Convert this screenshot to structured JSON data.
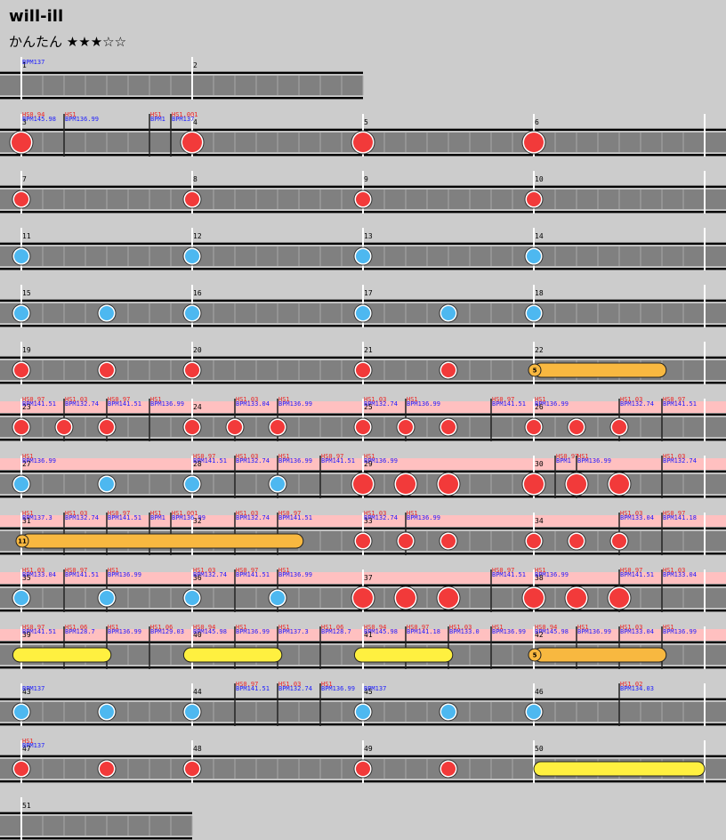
{
  "song": {
    "title": "will-ill",
    "difficulty": "かんたん",
    "stars": "★★★☆☆"
  },
  "colors": {
    "background": "#cccccc",
    "lane": "#808080",
    "lane_border": "#000000",
    "highlight_row": "#ffc0c0",
    "don": "#f23a3a",
    "ka": "#4db8f0",
    "drumroll": "#f8b840",
    "balloon": "#fff040",
    "bpm_text": "#1a1aff",
    "hs_text": "#ee2222"
  },
  "rows": [
    {
      "measures": [
        {
          "n": "1",
          "beats": 4
        },
        {
          "n": "2",
          "beats": 4
        }
      ],
      "highlight": false,
      "events": [
        {
          "t": 0,
          "bpm": "BPM137"
        }
      ],
      "notes": []
    },
    {
      "measures": [
        {
          "n": "3",
          "beats": 4
        },
        {
          "n": "4",
          "beats": 4
        },
        {
          "n": "5",
          "beats": 4
        },
        {
          "n": "6",
          "beats": 4
        }
      ],
      "highlight": false,
      "events": [
        {
          "t": 0,
          "hs": "HS0.94",
          "bpm": "BPM145.98"
        },
        {
          "t": 1,
          "hs": "HS1",
          "bpm": "BPM136.99"
        },
        {
          "t": 3,
          "hs": "HS1",
          "bpm": "BPM1"
        },
        {
          "t": 3.5,
          "hs": "HS1.001",
          "bpm": "BPM137"
        }
      ],
      "notes": [
        {
          "t": 0,
          "k": "D"
        },
        {
          "t": 4,
          "k": "D"
        },
        {
          "t": 8,
          "k": "D"
        },
        {
          "t": 12,
          "k": "D"
        }
      ]
    },
    {
      "measures": [
        {
          "n": "7",
          "beats": 4
        },
        {
          "n": "8",
          "beats": 4
        },
        {
          "n": "9",
          "beats": 4
        },
        {
          "n": "10",
          "beats": 4
        }
      ],
      "highlight": false,
      "events": [],
      "notes": [
        {
          "t": 0,
          "k": "d"
        },
        {
          "t": 4,
          "k": "d"
        },
        {
          "t": 8,
          "k": "d"
        },
        {
          "t": 12,
          "k": "d"
        }
      ]
    },
    {
      "measures": [
        {
          "n": "11",
          "beats": 4
        },
        {
          "n": "12",
          "beats": 4
        },
        {
          "n": "13",
          "beats": 4
        },
        {
          "n": "14",
          "beats": 4
        }
      ],
      "highlight": false,
      "events": [],
      "notes": [
        {
          "t": 0,
          "k": "k"
        },
        {
          "t": 4,
          "k": "k"
        },
        {
          "t": 8,
          "k": "k"
        },
        {
          "t": 12,
          "k": "k"
        }
      ]
    },
    {
      "measures": [
        {
          "n": "15",
          "beats": 4
        },
        {
          "n": "16",
          "beats": 4
        },
        {
          "n": "17",
          "beats": 4
        },
        {
          "n": "18",
          "beats": 4
        }
      ],
      "highlight": false,
      "events": [],
      "notes": [
        {
          "t": 0,
          "k": "k"
        },
        {
          "t": 2,
          "k": "k"
        },
        {
          "t": 4,
          "k": "k"
        },
        {
          "t": 8,
          "k": "k"
        },
        {
          "t": 10,
          "k": "k"
        },
        {
          "t": 12,
          "k": "k"
        }
      ]
    },
    {
      "measures": [
        {
          "n": "19",
          "beats": 4
        },
        {
          "n": "20",
          "beats": 4
        },
        {
          "n": "21",
          "beats": 4
        },
        {
          "n": "22",
          "beats": 4
        }
      ],
      "highlight": false,
      "events": [],
      "notes": [
        {
          "t": 0,
          "k": "d"
        },
        {
          "t": 2,
          "k": "d"
        },
        {
          "t": 4,
          "k": "d"
        },
        {
          "t": 8,
          "k": "d"
        },
        {
          "t": 10,
          "k": "d"
        },
        {
          "t": 12,
          "k": "r",
          "end": 15.1,
          "label": "5"
        }
      ]
    },
    {
      "measures": [
        {
          "n": "23",
          "beats": 4
        },
        {
          "n": "24",
          "beats": 4
        },
        {
          "n": "25",
          "beats": 4
        },
        {
          "n": "26",
          "beats": 4
        }
      ],
      "highlight": true,
      "events": [
        {
          "t": 0,
          "hs": "HS0.97",
          "bpm": "BPM141.51"
        },
        {
          "t": 1,
          "hs": "HS1.03",
          "bpm": "BPM132.74"
        },
        {
          "t": 2,
          "hs": "HS0.97",
          "bpm": "BPM141.51"
        },
        {
          "t": 3,
          "hs": "HS1",
          "bpm": "BPM136.99"
        },
        {
          "t": 5,
          "hs": "HS1.03",
          "bpm": "BPM133.04"
        },
        {
          "t": 6,
          "hs": "HS1",
          "bpm": "BPM136.99"
        },
        {
          "t": 8,
          "hs": "HS1.03",
          "bpm": "BPM132.74"
        },
        {
          "t": 9,
          "hs": "HS1",
          "bpm": "BPM136.99"
        },
        {
          "t": 11,
          "hs": "HS0.97",
          "bpm": "BPM141.51"
        },
        {
          "t": 12,
          "hs": "HS1",
          "bpm": "BPM136.99"
        },
        {
          "t": 14,
          "hs": "HS1.03",
          "bpm": "BPM132.74"
        },
        {
          "t": 15,
          "hs": "HS0.97",
          "bpm": "BPM141.51"
        }
      ],
      "notes": [
        {
          "t": 0,
          "k": "d"
        },
        {
          "t": 1,
          "k": "d"
        },
        {
          "t": 2,
          "k": "d"
        },
        {
          "t": 4,
          "k": "d"
        },
        {
          "t": 5,
          "k": "d"
        },
        {
          "t": 6,
          "k": "d"
        },
        {
          "t": 8,
          "k": "d"
        },
        {
          "t": 9,
          "k": "d"
        },
        {
          "t": 10,
          "k": "d"
        },
        {
          "t": 12,
          "k": "d"
        },
        {
          "t": 13,
          "k": "d"
        },
        {
          "t": 14,
          "k": "d"
        }
      ]
    },
    {
      "measures": [
        {
          "n": "27",
          "beats": 4
        },
        {
          "n": "28",
          "beats": 4
        },
        {
          "n": "29",
          "beats": 4
        },
        {
          "n": "30",
          "beats": 4
        }
      ],
      "highlight": true,
      "events": [
        {
          "t": 0,
          "hs": "HS1",
          "bpm": "BPM136.99"
        },
        {
          "t": 4,
          "hs": "HS0.97",
          "bpm": "BPM141.51"
        },
        {
          "t": 5,
          "hs": "HS1.03",
          "bpm": "BPM132.74"
        },
        {
          "t": 6,
          "hs": "HS1",
          "bpm": "BPM136.99"
        },
        {
          "t": 7,
          "hs": "HS0.97",
          "bpm": "BPM141.51"
        },
        {
          "t": 8,
          "hs": "HS1",
          "bpm": "BPM136.99"
        },
        {
          "t": 12.5,
          "hs": "HS0.97",
          "bpm": "BPM1"
        },
        {
          "t": 13,
          "hs": "HS1",
          "bpm": "BPM136.99"
        },
        {
          "t": 15,
          "hs": "HS1.03",
          "bpm": "BPM132.74"
        }
      ],
      "notes": [
        {
          "t": 0,
          "k": "k"
        },
        {
          "t": 2,
          "k": "k"
        },
        {
          "t": 4,
          "k": "k"
        },
        {
          "t": 6,
          "k": "k"
        },
        {
          "t": 8,
          "k": "D"
        },
        {
          "t": 9,
          "k": "D"
        },
        {
          "t": 10,
          "k": "D"
        },
        {
          "t": 12,
          "k": "D"
        },
        {
          "t": 13,
          "k": "D"
        },
        {
          "t": 14,
          "k": "D"
        }
      ]
    },
    {
      "measures": [
        {
          "n": "31",
          "beats": 4
        },
        {
          "n": "32",
          "beats": 4
        },
        {
          "n": "33",
          "beats": 4
        },
        {
          "n": "34",
          "beats": 4
        }
      ],
      "highlight": true,
      "events": [
        {
          "t": 0,
          "hs": "HS1",
          "bpm": "BPM137.3"
        },
        {
          "t": 1,
          "hs": "HS1.03",
          "bpm": "BPM132.74"
        },
        {
          "t": 2,
          "hs": "HS0.97",
          "bpm": "BPM141.51"
        },
        {
          "t": 3,
          "hs": "HS1",
          "bpm": "BPM1"
        },
        {
          "t": 3.5,
          "hs": "HS1.001",
          "bpm": "BPM136.99"
        },
        {
          "t": 5,
          "hs": "HS1.03",
          "bpm": "BPM132.74"
        },
        {
          "t": 6,
          "hs": "HS0.97",
          "bpm": "BPM141.51"
        },
        {
          "t": 8,
          "hs": "HS1.03",
          "bpm": "BPM132.74"
        },
        {
          "t": 9,
          "hs": "HS1",
          "bpm": "BPM136.99"
        },
        {
          "t": 14,
          "hs": "HS1.03",
          "bpm": "BPM133.04"
        },
        {
          "t": 15,
          "hs": "HS0.97",
          "bpm": "BPM141.18"
        }
      ],
      "notes": [
        {
          "t": 0,
          "k": "r",
          "end": 6.6,
          "label": "11"
        },
        {
          "t": 8,
          "k": "d"
        },
        {
          "t": 9,
          "k": "d"
        },
        {
          "t": 10,
          "k": "d"
        },
        {
          "t": 12,
          "k": "d"
        },
        {
          "t": 13,
          "k": "d"
        },
        {
          "t": 14,
          "k": "d"
        }
      ]
    },
    {
      "measures": [
        {
          "n": "35",
          "beats": 4
        },
        {
          "n": "36",
          "beats": 4
        },
        {
          "n": "37",
          "beats": 4
        },
        {
          "n": "38",
          "beats": 4
        }
      ],
      "highlight": true,
      "events": [
        {
          "t": 0,
          "hs": "HS1.03",
          "bpm": "BPM133.04"
        },
        {
          "t": 1,
          "hs": "HS0.97",
          "bpm": "BPM141.51"
        },
        {
          "t": 2,
          "hs": "HS1",
          "bpm": "BPM136.99"
        },
        {
          "t": 4,
          "hs": "HS1.03",
          "bpm": "BPM132.74"
        },
        {
          "t": 5,
          "hs": "HS0.97",
          "bpm": "BPM141.51"
        },
        {
          "t": 6,
          "hs": "HS1",
          "bpm": "BPM136.99"
        },
        {
          "t": 11,
          "hs": "HS0.97",
          "bpm": "BPM141.51"
        },
        {
          "t": 12,
          "hs": "HS1",
          "bpm": "BPM136.99"
        },
        {
          "t": 14,
          "hs": "HS0.97",
          "bpm": "BPM141.51"
        },
        {
          "t": 15,
          "hs": "HS1.03",
          "bpm": "BPM133.04"
        }
      ],
      "notes": [
        {
          "t": 0,
          "k": "k"
        },
        {
          "t": 2,
          "k": "k"
        },
        {
          "t": 4,
          "k": "k"
        },
        {
          "t": 6,
          "k": "k"
        },
        {
          "t": 8,
          "k": "D"
        },
        {
          "t": 9,
          "k": "D"
        },
        {
          "t": 10,
          "k": "D"
        },
        {
          "t": 12,
          "k": "D"
        },
        {
          "t": 13,
          "k": "D"
        },
        {
          "t": 14,
          "k": "D"
        }
      ]
    },
    {
      "measures": [
        {
          "n": "39",
          "beats": 4
        },
        {
          "n": "40",
          "beats": 4
        },
        {
          "n": "41",
          "beats": 4
        },
        {
          "n": "42",
          "beats": 4
        }
      ],
      "highlight": true,
      "events": [
        {
          "t": 0,
          "hs": "HS0.97",
          "bpm": "BPM141.51"
        },
        {
          "t": 1,
          "hs": "HS1.06",
          "bpm": "BPM128.7"
        },
        {
          "t": 2,
          "hs": "HS1",
          "bpm": "BPM136.99"
        },
        {
          "t": 3,
          "hs": "HS1.06",
          "bpm": "BPM129.03"
        },
        {
          "t": 4,
          "hs": "HS0.94",
          "bpm": "BPM145.98"
        },
        {
          "t": 5,
          "hs": "HS1",
          "bpm": "BPM136.99"
        },
        {
          "t": 6,
          "hs": "HS1",
          "bpm": "BPM137.3"
        },
        {
          "t": 7,
          "hs": "HS1.06",
          "bpm": "BPM128.7"
        },
        {
          "t": 8,
          "hs": "HS0.94",
          "bpm": "BPM145.98"
        },
        {
          "t": 9,
          "hs": "HS0.97",
          "bpm": "BPM141.18"
        },
        {
          "t": 10,
          "hs": "HS1.03",
          "bpm": "BPM133.0"
        },
        {
          "t": 11,
          "hs": "HS1",
          "bpm": "BPM136.99"
        },
        {
          "t": 12,
          "hs": "HS0.94",
          "bpm": "BPM145.98"
        },
        {
          "t": 13,
          "hs": "HS1",
          "bpm": "BPM136.99"
        },
        {
          "t": 14,
          "hs": "HS1.03",
          "bpm": "BPM133.04"
        },
        {
          "t": 15,
          "hs": "HS1",
          "bpm": "BPM136.99"
        }
      ],
      "notes": [
        {
          "t": -0.2,
          "k": "b",
          "end": 2.1
        },
        {
          "t": 3.8,
          "k": "b",
          "end": 6.1
        },
        {
          "t": 7.8,
          "k": "b",
          "end": 10.1
        },
        {
          "t": 12,
          "k": "r",
          "end": 15.1,
          "label": "5"
        }
      ]
    },
    {
      "measures": [
        {
          "n": "43",
          "beats": 4
        },
        {
          "n": "44",
          "beats": 4
        },
        {
          "n": "45",
          "beats": 4
        },
        {
          "n": "46",
          "beats": 4
        }
      ],
      "highlight": false,
      "events": [
        {
          "t": 0,
          "bpm": "BPM137"
        },
        {
          "t": 5,
          "hs": "HS0.97",
          "bpm": "BPM141.51"
        },
        {
          "t": 6,
          "hs": "HS1.03",
          "bpm": "BPM132.74"
        },
        {
          "t": 7,
          "hs": "HS1",
          "bpm": "BPM136.99"
        },
        {
          "t": 8,
          "bpm": "BPM137"
        },
        {
          "t": 14,
          "hs": "HS1.02",
          "bpm": "BPM134.03"
        }
      ],
      "notes": [
        {
          "t": 0,
          "k": "k"
        },
        {
          "t": 2,
          "k": "k"
        },
        {
          "t": 4,
          "k": "k"
        },
        {
          "t": 8,
          "k": "k"
        },
        {
          "t": 10,
          "k": "k"
        },
        {
          "t": 12,
          "k": "k"
        }
      ]
    },
    {
      "measures": [
        {
          "n": "47",
          "beats": 4
        },
        {
          "n": "48",
          "beats": 4
        },
        {
          "n": "49",
          "beats": 4
        },
        {
          "n": "50",
          "beats": 4
        }
      ],
      "highlight": false,
      "events": [
        {
          "t": 0,
          "hs": "HS1",
          "bpm": "BPM137"
        }
      ],
      "notes": [
        {
          "t": 0,
          "k": "d"
        },
        {
          "t": 2,
          "k": "d"
        },
        {
          "t": 4,
          "k": "d"
        },
        {
          "t": 8,
          "k": "d"
        },
        {
          "t": 10,
          "k": "d"
        },
        {
          "t": 12,
          "k": "b",
          "end": 16
        }
      ]
    },
    {
      "measures": [
        {
          "n": "51",
          "beats": 4
        }
      ],
      "highlight": false,
      "events": [],
      "notes": []
    }
  ]
}
